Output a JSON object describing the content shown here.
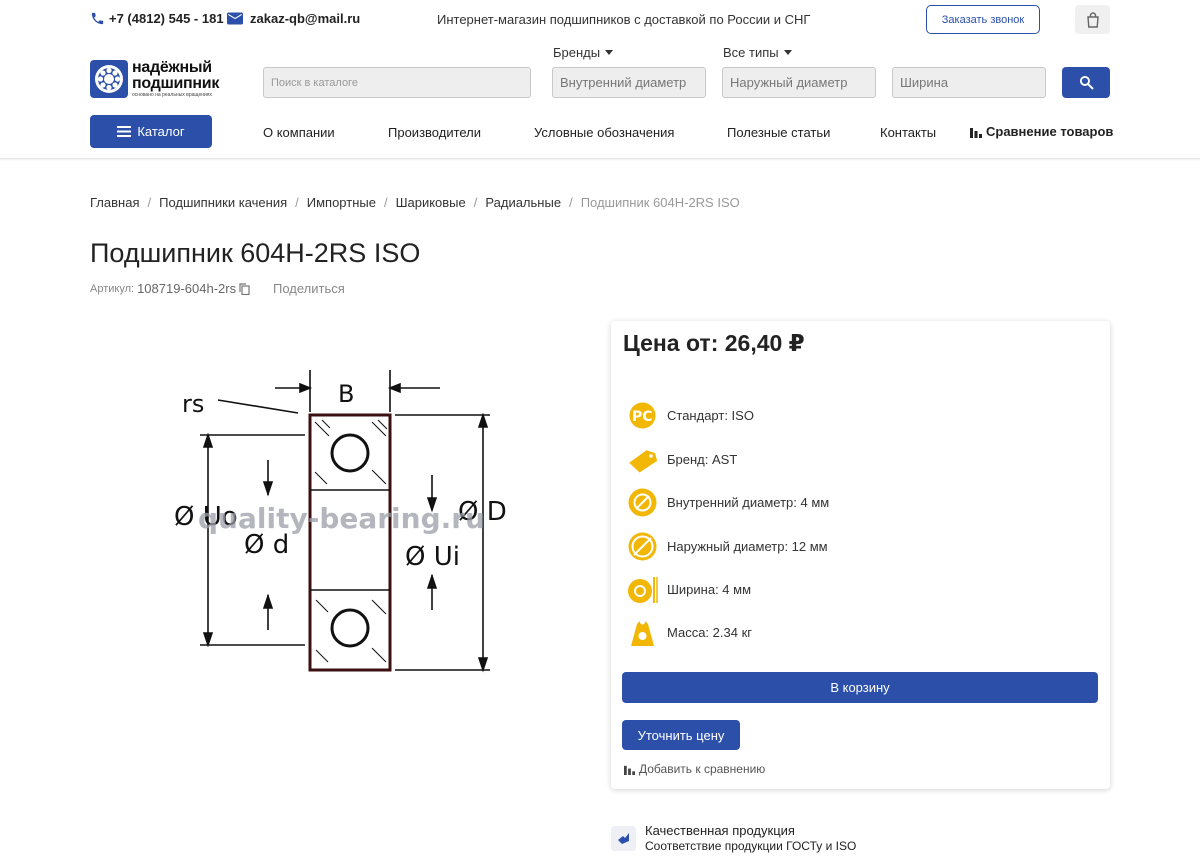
{
  "topbar": {
    "phone": "+7 (4812) 545 - 181",
    "email": "zakaz-qb@mail.ru",
    "tagline": "Интернет-магазин подшипников с доставкой по России и СНГ",
    "callback_label": "Заказать звонок"
  },
  "logo": {
    "line1": "надёжный",
    "line2": "подшипник",
    "line3": "основано на реальных вращениях"
  },
  "search": {
    "catalog_placeholder": "Поиск в каталоге",
    "brands_label": "Бренды",
    "types_label": "Все типы",
    "inner_placeholder": "Внутренний диаметр",
    "outer_placeholder": "Наружный диаметр",
    "width_placeholder": "Ширина"
  },
  "nav": {
    "catalog_label": "Каталог",
    "items": [
      "О компании",
      "Производители",
      "Условные обозначения",
      "Полезные статьи",
      "Контакты"
    ],
    "compare_label": "Сравнение товаров"
  },
  "breadcrumb": [
    "Главная",
    "Подшипники качения",
    "Импортные",
    "Шариковые",
    "Радиальные",
    "Подшипник 604H-2RS ISO"
  ],
  "product": {
    "title": "Подшипник 604H-2RS ISO",
    "article_label": "Артикул:",
    "article_value": "108719-604h-2rs",
    "share_label": "Поделиться",
    "drawing": {
      "labels": [
        "rs",
        "B",
        "Ø Uo",
        "Ø d",
        "Ø D",
        "Ø Ui"
      ],
      "watermark": "quality-bearing.ru"
    }
  },
  "price_card": {
    "price": "Цена от: 26,40 ₽",
    "features": [
      {
        "icon": "standard-icon",
        "text": "Стандарт: ISO"
      },
      {
        "icon": "brand-tag-icon",
        "text": "Бренд: AST"
      },
      {
        "icon": "inner-diameter-icon",
        "text": "Внутренний диаметр: 4 мм"
      },
      {
        "icon": "outer-diameter-icon",
        "text": "Наружный диаметр: 12 мм"
      },
      {
        "icon": "width-icon",
        "text": "Ширина: 4 мм"
      },
      {
        "icon": "weight-icon",
        "text": "Масса: 2.34 кг"
      }
    ],
    "add_to_cart_label": "В корзину",
    "clarify_price_label": "Уточнить цену",
    "add_compare_label": "Добавить к сравнению"
  },
  "quality": {
    "title": "Качественная продукция",
    "subtitle": "Соответствие продукции ГОСТу и ISO"
  },
  "colors": {
    "accent": "#2c4faa",
    "icon_gold": "#f2b705"
  }
}
